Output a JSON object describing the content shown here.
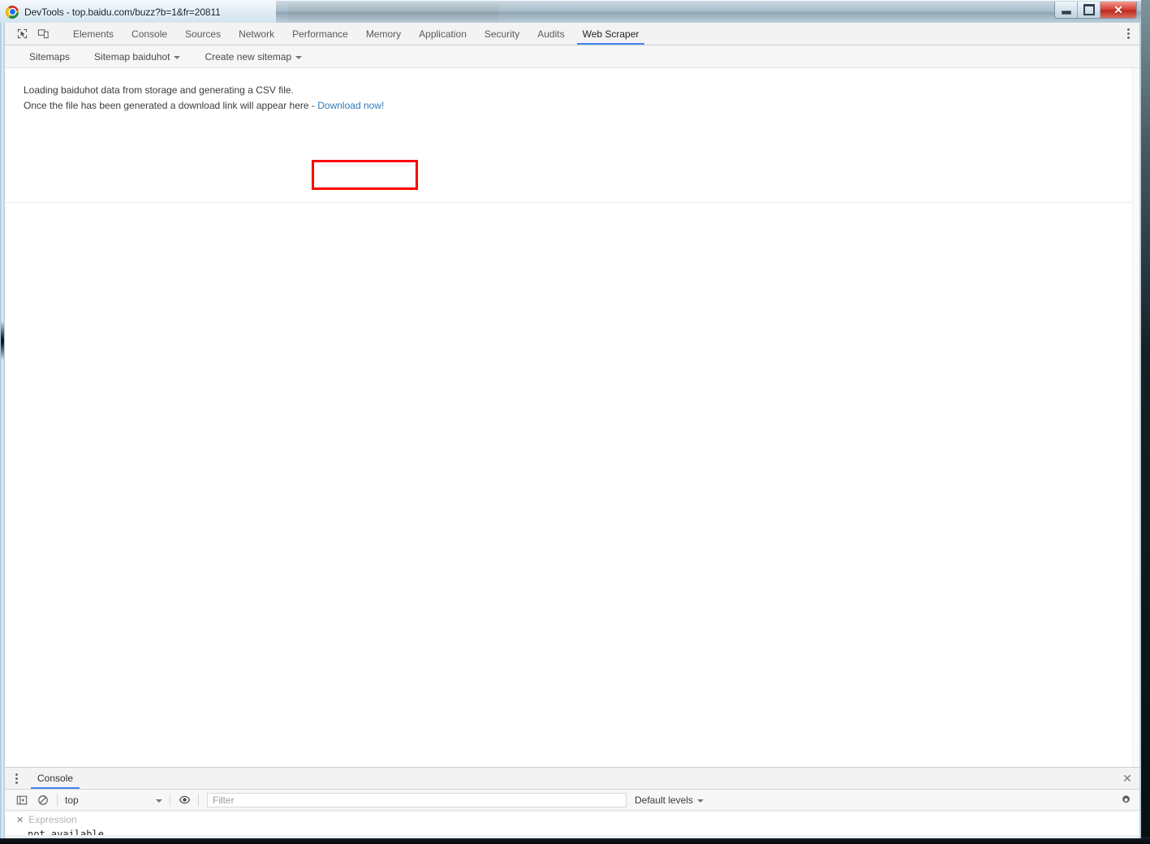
{
  "window": {
    "title": "DevTools - top.baidu.com/buzz?b=1&fr=20811",
    "logo_icon": "chrome-logo-icon",
    "buttons": {
      "minimize_label": "",
      "maximize_label": "",
      "close_label": "✕"
    }
  },
  "colors": {
    "accent": "#4285f4",
    "link": "#337ab7",
    "annotation": "#ff0000",
    "titlebar_text": "#10202e"
  },
  "toolbar_icons": {
    "inspect": "inspect-element-icon",
    "device": "device-toolbar-icon",
    "more": "more-tabs-icon"
  },
  "tabs": [
    {
      "label": "Elements",
      "active": false
    },
    {
      "label": "Console",
      "active": false
    },
    {
      "label": "Sources",
      "active": false
    },
    {
      "label": "Network",
      "active": false
    },
    {
      "label": "Performance",
      "active": false
    },
    {
      "label": "Memory",
      "active": false
    },
    {
      "label": "Application",
      "active": false
    },
    {
      "label": "Security",
      "active": false
    },
    {
      "label": "Audits",
      "active": false
    },
    {
      "label": "Web Scraper",
      "active": true
    }
  ],
  "subnav": {
    "items": [
      {
        "label": "Sitemaps",
        "dropdown": false
      },
      {
        "label": "Sitemap baiduhot",
        "dropdown": true
      },
      {
        "label": "Create new sitemap",
        "dropdown": true
      }
    ]
  },
  "panel": {
    "line1": "Loading baiduhot data from storage and generating a CSV file.",
    "line2_prefix": "Once the file has been generated a download link will appear here -",
    "download_link": "Download now!"
  },
  "drawer": {
    "menu_icon": "more-tools-icon",
    "tab_label": "Console",
    "close_icon": "close-icon",
    "toolbar": {
      "sidebar_icon": "console-sidebar-icon",
      "clear_icon": "clear-console-icon",
      "context_value": "top",
      "eye_icon": "live-expression-eye-icon",
      "filter_placeholder": "Filter",
      "levels_value": "Default levels",
      "settings_icon": "settings-gear-icon"
    },
    "live_expression": {
      "close_icon": "✕",
      "placeholder": "Expression",
      "value": "not available"
    }
  }
}
